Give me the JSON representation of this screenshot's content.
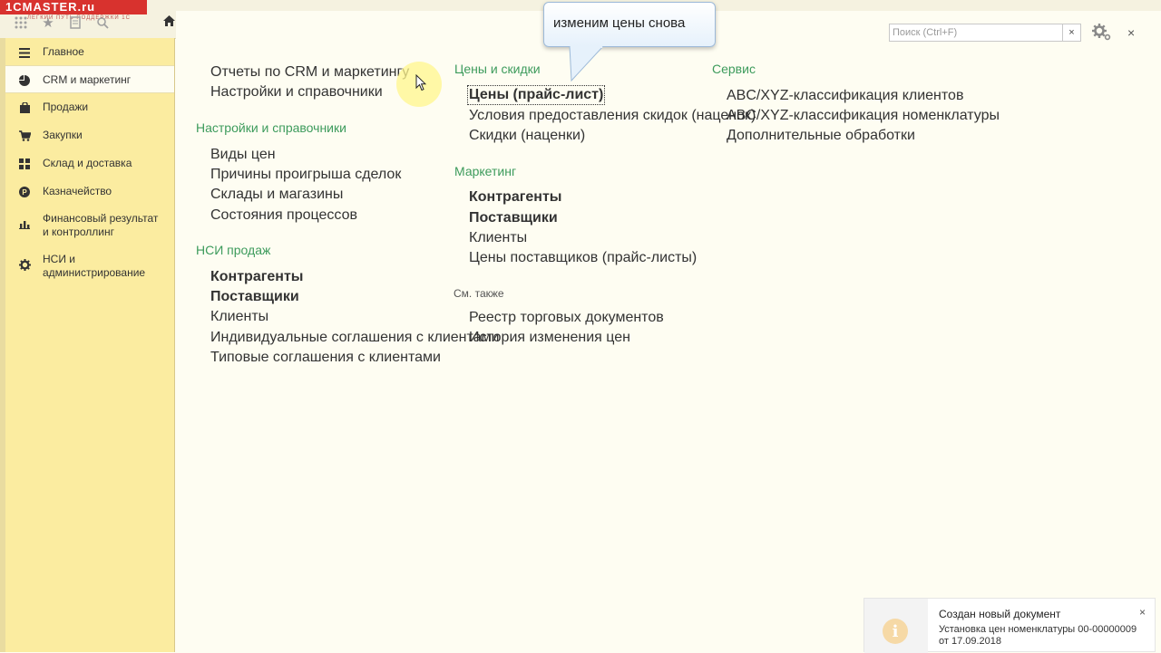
{
  "logo": {
    "text": "1CMASTER.ru",
    "subtitle": "ЛЕГКИЙ ПУТЬ ПОДДЕРЖКИ 1С"
  },
  "toolbar": {
    "icons": [
      "apps-grid-icon",
      "star-icon",
      "history-icon",
      "search-icon"
    ],
    "home_icon": "home-icon"
  },
  "sidebar": {
    "items": [
      {
        "label": "Главное",
        "icon": "menu-lines-icon",
        "active": false
      },
      {
        "label": "CRM и маркетинг",
        "icon": "pie-chart-icon",
        "active": true
      },
      {
        "label": "Продажи",
        "icon": "shopping-bag-icon",
        "active": false
      },
      {
        "label": "Закупки",
        "icon": "cart-icon",
        "active": false
      },
      {
        "label": "Склад и доставка",
        "icon": "warehouse-grid-icon",
        "active": false
      },
      {
        "label": "Казначейство",
        "icon": "coin-icon",
        "active": false
      },
      {
        "label": "Финансовый результат и контроллинг",
        "icon": "bar-chart-icon",
        "active": false
      },
      {
        "label": "НСИ и администрирование",
        "icon": "gear-icon",
        "active": false
      }
    ]
  },
  "search": {
    "placeholder": "Поиск (Ctrl+F)",
    "value": "",
    "clear": "×"
  },
  "window": {
    "close": "×"
  },
  "callout": {
    "text": "изменим цены снова"
  },
  "col1": {
    "links_top": [
      "Отчеты по CRM и маркетингу",
      "Настройки и справочники"
    ],
    "section2_title": "Настройки и справочники",
    "section2_links": [
      "Виды цен",
      "Причины проигрыша сделок",
      "Склады и магазины",
      "Состояния процессов"
    ],
    "section3_title": "НСИ продаж",
    "section3_links": [
      "Контрагенты",
      "Поставщики",
      "Клиенты",
      "Индивидуальные соглашения с клиентами",
      "Типовые соглашения с клиентами"
    ]
  },
  "col2": {
    "section1_title": "Цены и скидки",
    "section1_links": [
      "Цены (прайс-лист)",
      "Условия предоставления скидок (наценок)",
      "Скидки (наценки)"
    ],
    "section2_title": "Маркетинг",
    "section2_links": [
      "Контрагенты",
      "Поставщики",
      "Клиенты",
      "Цены поставщиков (прайс-листы)"
    ],
    "see_also_title": "См. также",
    "see_also_links": [
      "Реестр торговых документов",
      "История изменения цен"
    ]
  },
  "col3": {
    "section1_title": "Сервис",
    "section1_links": [
      "ABC/XYZ-классификация клиентов",
      "ABC/XYZ-классификация номенклатуры",
      "Дополнительные обработки"
    ]
  },
  "notification": {
    "title": "Создан новый документ",
    "line1": "Установка цен номенклатуры 00-00000009",
    "line2": "от 17.09.2018",
    "icon_glyph": "i",
    "close": "×"
  }
}
